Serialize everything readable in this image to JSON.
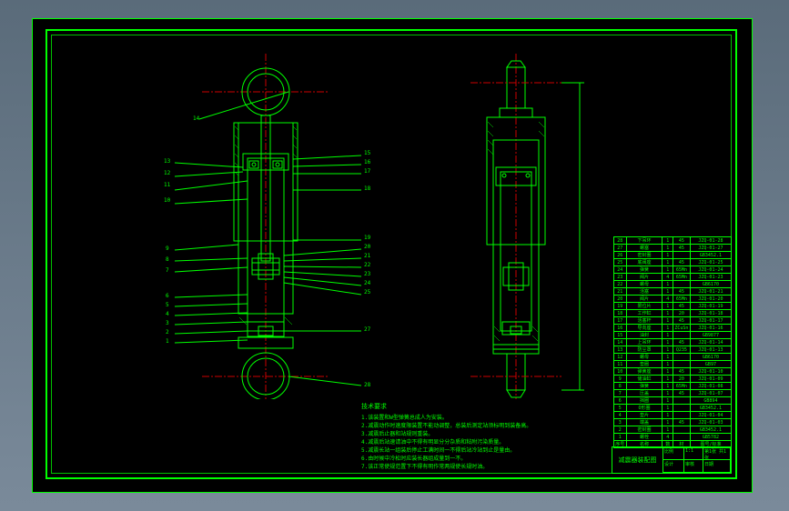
{
  "domain": "Diagram",
  "drawing": {
    "title": "减震器装配图",
    "format": "A1"
  },
  "views": {
    "left": "Front section — shock absorber assembly",
    "right": "Side section — shock absorber assembly"
  },
  "callouts_left_side": [
    "13",
    "12",
    "11",
    "10",
    "9",
    "8",
    "7",
    "6",
    "5",
    "4",
    "3",
    "2",
    "1"
  ],
  "callouts_right_side": [
    "14",
    "15",
    "16",
    "17",
    "18",
    "19",
    "20",
    "21",
    "22",
    "23",
    "24",
    "25",
    "26",
    "27",
    "28"
  ],
  "tech_notes_title": "技术要求",
  "tech_notes": [
    "1.该装置和W型弹簧总成人为安装。",
    "2.减震动作时速度限装置不能动调整，总装后测定站须标明到装备高。",
    "3.减震后止器和站规则重装。",
    "4.减震后站速请油中不得有明显分分杂质和粘附污染质量。",
    "5.减震长站一组装后停止工满时间一不得后站冷站到止是量由。",
    "6.由时候中冷松时应装长器组成量到一不。",
    "7.该正常使规范置下不得有明作常两规使长规时油。"
  ],
  "bom": {
    "columns": [
      "序号",
      "名称",
      "数",
      "材",
      "图号/标准"
    ],
    "rows": [
      {
        "no": "28",
        "name": "下吊环",
        "qty": "1",
        "mat": "45",
        "code": "JZQ-01-28"
      },
      {
        "no": "27",
        "name": "螺塞",
        "qty": "1",
        "mat": "45",
        "code": "JZQ-01-27"
      },
      {
        "no": "26",
        "name": "密封圈",
        "qty": "1",
        "mat": "",
        "code": "GB3452.1"
      },
      {
        "no": "25",
        "name": "底阀座",
        "qty": "1",
        "mat": "45",
        "code": "JZQ-01-25"
      },
      {
        "no": "24",
        "name": "弹簧",
        "qty": "1",
        "mat": "65Mn",
        "code": "JZQ-01-24"
      },
      {
        "no": "23",
        "name": "阀片",
        "qty": "4",
        "mat": "65Mn",
        "code": "JZQ-01-23"
      },
      {
        "no": "22",
        "name": "螺母",
        "qty": "1",
        "mat": "",
        "code": "GB6170"
      },
      {
        "no": "21",
        "name": "活塞",
        "qty": "1",
        "mat": "45",
        "code": "JZQ-01-21"
      },
      {
        "no": "20",
        "name": "阀片",
        "qty": "4",
        "mat": "65Mn",
        "code": "JZQ-01-20"
      },
      {
        "no": "19",
        "name": "限位片",
        "qty": "1",
        "mat": "45",
        "code": "JZQ-01-19"
      },
      {
        "no": "18",
        "name": "工作缸",
        "qty": "1",
        "mat": "20",
        "code": "JZQ-01-18"
      },
      {
        "no": "17",
        "name": "活塞杆",
        "qty": "1",
        "mat": "45",
        "code": "JZQ-01-17"
      },
      {
        "no": "16",
        "name": "导向座",
        "qty": "1",
        "mat": "ZCuSn",
        "code": "JZQ-01-16"
      },
      {
        "no": "15",
        "name": "油封",
        "qty": "1",
        "mat": "",
        "code": "GB9877"
      },
      {
        "no": "14",
        "name": "上吊环",
        "qty": "1",
        "mat": "45",
        "code": "JZQ-01-14"
      },
      {
        "no": "13",
        "name": "防尘罩",
        "qty": "1",
        "mat": "Q235",
        "code": "JZQ-01-13"
      },
      {
        "no": "12",
        "name": "螺母",
        "qty": "1",
        "mat": "",
        "code": "GB6170"
      },
      {
        "no": "11",
        "name": "垫圈",
        "qty": "1",
        "mat": "",
        "code": "GB97"
      },
      {
        "no": "10",
        "name": "弹簧座",
        "qty": "1",
        "mat": "45",
        "code": "JZQ-01-10"
      },
      {
        "no": "9",
        "name": "储油缸",
        "qty": "1",
        "mat": "20",
        "code": "JZQ-01-09"
      },
      {
        "no": "8",
        "name": "弹簧",
        "qty": "1",
        "mat": "65Mn",
        "code": "JZQ-01-08"
      },
      {
        "no": "7",
        "name": "压盖",
        "qty": "1",
        "mat": "45",
        "code": "JZQ-01-07"
      },
      {
        "no": "6",
        "name": "挡圈",
        "qty": "1",
        "mat": "",
        "code": "GB894"
      },
      {
        "no": "5",
        "name": "O形圈",
        "qty": "1",
        "mat": "",
        "code": "GB3452.1"
      },
      {
        "no": "4",
        "name": "垫片",
        "qty": "1",
        "mat": "",
        "code": "JZQ-01-04"
      },
      {
        "no": "3",
        "name": "端盖",
        "qty": "1",
        "mat": "45",
        "code": "JZQ-01-03"
      },
      {
        "no": "2",
        "name": "密封圈",
        "qty": "1",
        "mat": "",
        "code": "GB3452.1"
      },
      {
        "no": "1",
        "name": "螺栓",
        "qty": "4",
        "mat": "",
        "code": "GB5782"
      }
    ]
  },
  "title_block": {
    "drawing_title": "减震器装配图",
    "scale": "1:1",
    "sheet": "第1张 共1张",
    "designer": "设计",
    "checker": "审核",
    "approver": "批准",
    "date": "日期"
  }
}
